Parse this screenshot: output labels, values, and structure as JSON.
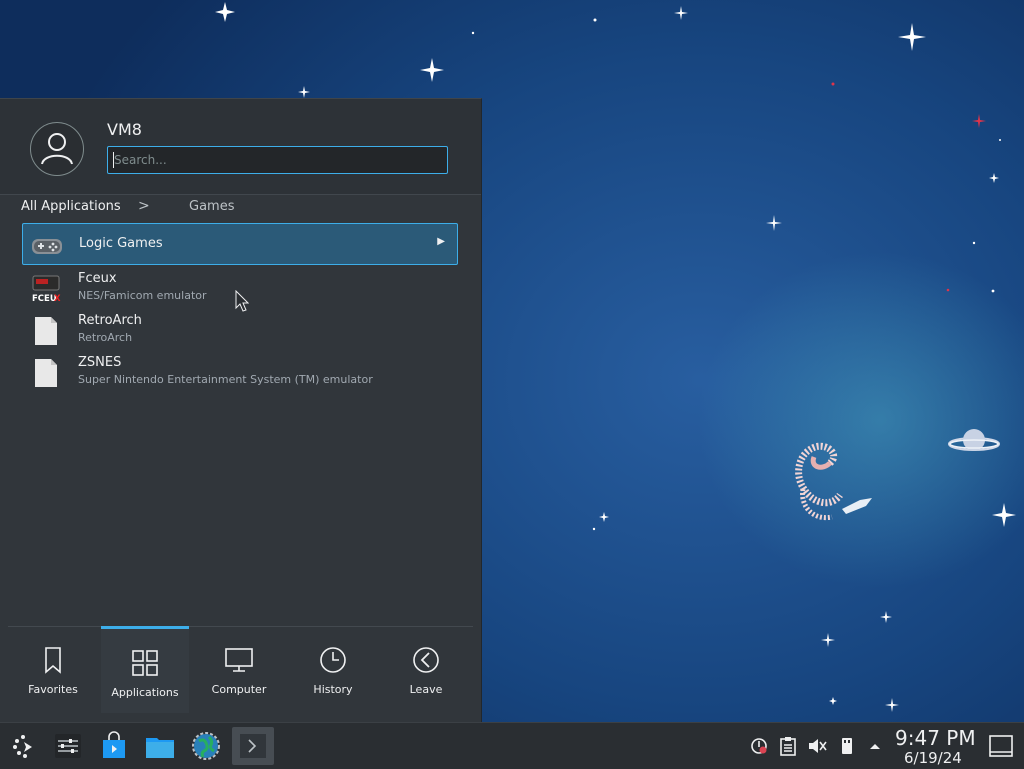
{
  "launcher": {
    "username": "VM8",
    "search_placeholder": "Search...",
    "breadcrumb": {
      "root": "All Applications",
      "separator": ">",
      "current": "Games"
    },
    "apps": [
      {
        "name": "Logic Games",
        "description": "",
        "icon": "gamepad-icon",
        "submenu": true,
        "selected": true
      },
      {
        "name": "Fceux",
        "description": "NES/Famicom emulator",
        "icon": "fceux-icon",
        "submenu": false,
        "selected": false
      },
      {
        "name": "RetroArch",
        "description": "RetroArch",
        "icon": "generic-file-icon",
        "submenu": false,
        "selected": false
      },
      {
        "name": "ZSNES",
        "description": "Super Nintendo Entertainment System (TM) emulator",
        "icon": "generic-file-icon",
        "submenu": false,
        "selected": false
      }
    ],
    "tabs": [
      {
        "label": "Favorites",
        "icon": "bookmark-icon",
        "active": false
      },
      {
        "label": "Applications",
        "icon": "grid-icon",
        "active": true
      },
      {
        "label": "Computer",
        "icon": "monitor-icon",
        "active": false
      },
      {
        "label": "History",
        "icon": "clock-icon",
        "active": false
      },
      {
        "label": "Leave",
        "icon": "leave-arrow-icon",
        "active": false
      }
    ]
  },
  "taskbar": {
    "launchers": [
      "application-launcher-icon",
      "system-settings-icon",
      "software-store-icon",
      "file-manager-icon",
      "web-browser-icon",
      "terminal-icon"
    ],
    "tray": [
      "update-notifier-icon",
      "clipboard-icon",
      "volume-muted-icon",
      "removable-device-icon",
      "expand-tray-icon"
    ],
    "clock": {
      "time": "9:47 PM",
      "date": "6/19/24"
    }
  },
  "colors": {
    "accent": "#3daee9",
    "panel": "#31363b",
    "taskbar": "#2a2e32",
    "selection": "#2b5a78"
  }
}
